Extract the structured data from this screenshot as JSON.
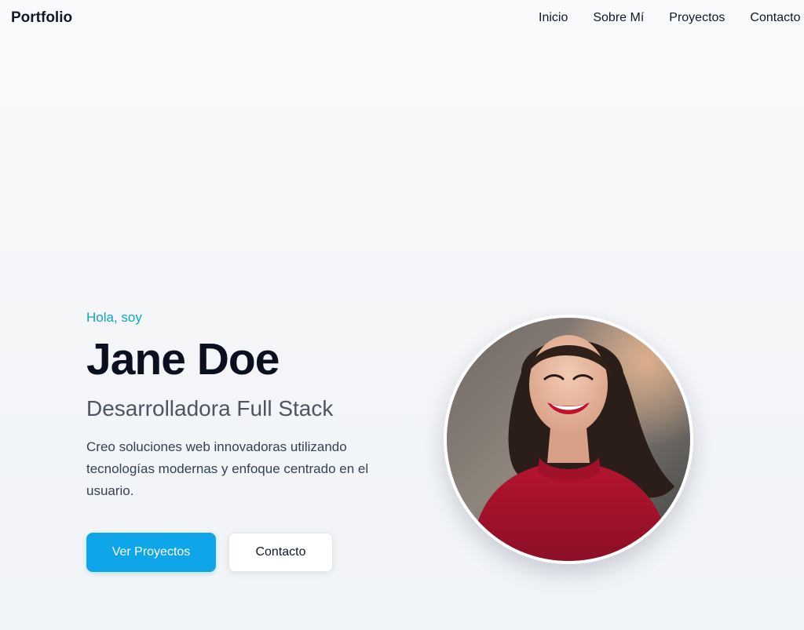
{
  "header": {
    "brand": "Portfolio",
    "nav": [
      {
        "label": "Inicio"
      },
      {
        "label": "Sobre Mí"
      },
      {
        "label": "Proyectos"
      },
      {
        "label": "Contacto"
      }
    ]
  },
  "hero": {
    "greeting": "Hola, soy",
    "name": "Jane Doe",
    "role": "Desarrolladora Full Stack",
    "description": "Creo soluciones web innovadoras utilizando tecnologías modernas y enfoque centrado en el usuario.",
    "primary_button": "Ver Proyectos",
    "secondary_button": "Contacto"
  },
  "colors": {
    "accent": "#0ea5e9",
    "greeting": "#0ea5c9",
    "heading": "#0b1020",
    "subheading": "#4b5563"
  }
}
